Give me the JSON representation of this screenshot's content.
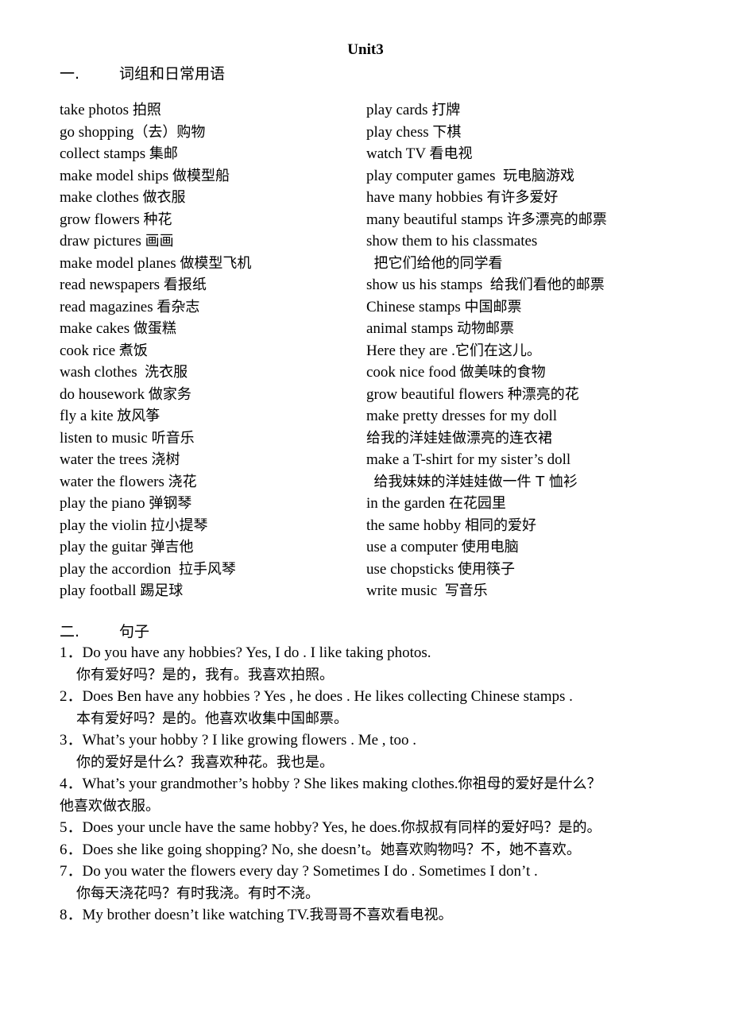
{
  "title": "Unit3",
  "section1": {
    "number": "一.",
    "heading": "词组和日常用语",
    "left_column": [
      {
        "en": "take photos ",
        "cn": "拍照"
      },
      {
        "en": "go shopping",
        "cn": "（去）购物"
      },
      {
        "en": "collect stamps ",
        "cn": "集邮"
      },
      {
        "en": "make model ships ",
        "cn": "做模型船"
      },
      {
        "en": "make clothes ",
        "cn": "做衣服"
      },
      {
        "en": "grow flowers ",
        "cn": "种花"
      },
      {
        "en": "draw pictures ",
        "cn": "画画"
      },
      {
        "en": "make model planes ",
        "cn": "做模型飞机"
      },
      {
        "en": "read newspapers ",
        "cn": "看报纸"
      },
      {
        "en": "read magazines ",
        "cn": "看杂志"
      },
      {
        "en": "make cakes ",
        "cn": "做蛋糕"
      },
      {
        "en": "cook rice ",
        "cn": "煮饭"
      },
      {
        "en": "wash clothes  ",
        "cn": "洗衣服"
      },
      {
        "en": "do housework ",
        "cn": "做家务"
      },
      {
        "en": "fly a kite ",
        "cn": "放风筝"
      },
      {
        "en": "listen to music ",
        "cn": "听音乐"
      },
      {
        "en": "water the trees ",
        "cn": "浇树"
      },
      {
        "en": "water the flowers ",
        "cn": "浇花"
      },
      {
        "en": "play the piano ",
        "cn": "弹钢琴"
      },
      {
        "en": "play the violin ",
        "cn": "拉小提琴"
      },
      {
        "en": "play the guitar ",
        "cn": "弹吉他"
      },
      {
        "en": "play the accordion  ",
        "cn": "拉手风琴"
      },
      {
        "en": "play football ",
        "cn": "踢足球"
      }
    ],
    "right_column": [
      {
        "en": "play cards ",
        "cn": "打牌"
      },
      {
        "en": "play chess ",
        "cn": "下棋"
      },
      {
        "en": "watch TV ",
        "cn": "看电视"
      },
      {
        "en": "play computer games  ",
        "cn": "玩电脑游戏"
      },
      {
        "en": "have many hobbies ",
        "cn": "有许多爱好"
      },
      {
        "en": "many beautiful stamps ",
        "cn": "许多漂亮的邮票"
      },
      {
        "en": "show them to his classmates",
        "cn": ""
      },
      {
        "en": "  ",
        "cn": "把它们给他的同学看"
      },
      {
        "en": "show us his stamps  ",
        "cn": "给我们看他的邮票"
      },
      {
        "en": "Chinese stamps ",
        "cn": "中国邮票"
      },
      {
        "en": "animal stamps ",
        "cn": "动物邮票"
      },
      {
        "en": "Here they are .",
        "cn": "它们在这儿。"
      },
      {
        "en": "cook nice food ",
        "cn": "做美味的食物"
      },
      {
        "en": "grow beautiful flowers ",
        "cn": "种漂亮的花"
      },
      {
        "en": "make pretty dresses for my doll",
        "cn": ""
      },
      {
        "en": "",
        "cn": "给我的洋娃娃做漂亮的连衣裙"
      },
      {
        "en": "make a T-shirt for my sister’s doll",
        "cn": ""
      },
      {
        "en": "  ",
        "cn": "给我妹妹的洋娃娃做一件 T 恤衫"
      },
      {
        "en": "in the garden ",
        "cn": "在花园里"
      },
      {
        "en": "the same hobby ",
        "cn": "相同的爱好"
      },
      {
        "en": "use a computer ",
        "cn": "使用电脑"
      },
      {
        "en": "use chopsticks ",
        "cn": "使用筷子"
      },
      {
        "en": "write music  ",
        "cn": "写音乐"
      }
    ]
  },
  "section2": {
    "number": "二.",
    "heading": "句子",
    "lines": [
      {
        "en": "1．Do you have any hobbies? Yes, I do . I like taking photos.",
        "cn": "",
        "indent": false
      },
      {
        "en": "",
        "cn": "你有爱好吗？是的，我有。我喜欢拍照。",
        "indent": true
      },
      {
        "en": "2．Does Ben have any hobbies ? Yes , he does . He likes collecting Chinese stamps .",
        "cn": "",
        "indent": false
      },
      {
        "en": "",
        "cn": "本有爱好吗？是的。他喜欢收集中国邮票。",
        "indent": true
      },
      {
        "en": "3．What’s your hobby ? I like growing flowers . Me , too .",
        "cn": "",
        "indent": false
      },
      {
        "en": "",
        "cn": "你的爱好是什么？我喜欢种花。我也是。",
        "indent": true
      },
      {
        "en": "4．What’s your grandmother’s hobby ? She likes making clothes.",
        "cn": "你祖母的爱好是什么？",
        "indent": false
      },
      {
        "en": "",
        "cn": "他喜欢做衣服。",
        "indent": false
      },
      {
        "en": "5．Does your uncle have the same hobby? Yes, he does.",
        "cn": "你叔叔有同样的爱好吗？是的。",
        "indent": false
      },
      {
        "en": "6．Does she like going shopping? No, she doesn’t。",
        "cn": "她喜欢购物吗？不，她不喜欢。",
        "indent": false
      },
      {
        "en": "7．Do you water the flowers every day ? Sometimes I do . Sometimes I don’t .",
        "cn": "",
        "indent": false
      },
      {
        "en": "",
        "cn": "你每天浇花吗？有时我浇。有时不浇。",
        "indent": true
      },
      {
        "en": "8．My brother doesn’t like watching TV.",
        "cn": "我哥哥不喜欢看电视。",
        "indent": false
      }
    ]
  }
}
